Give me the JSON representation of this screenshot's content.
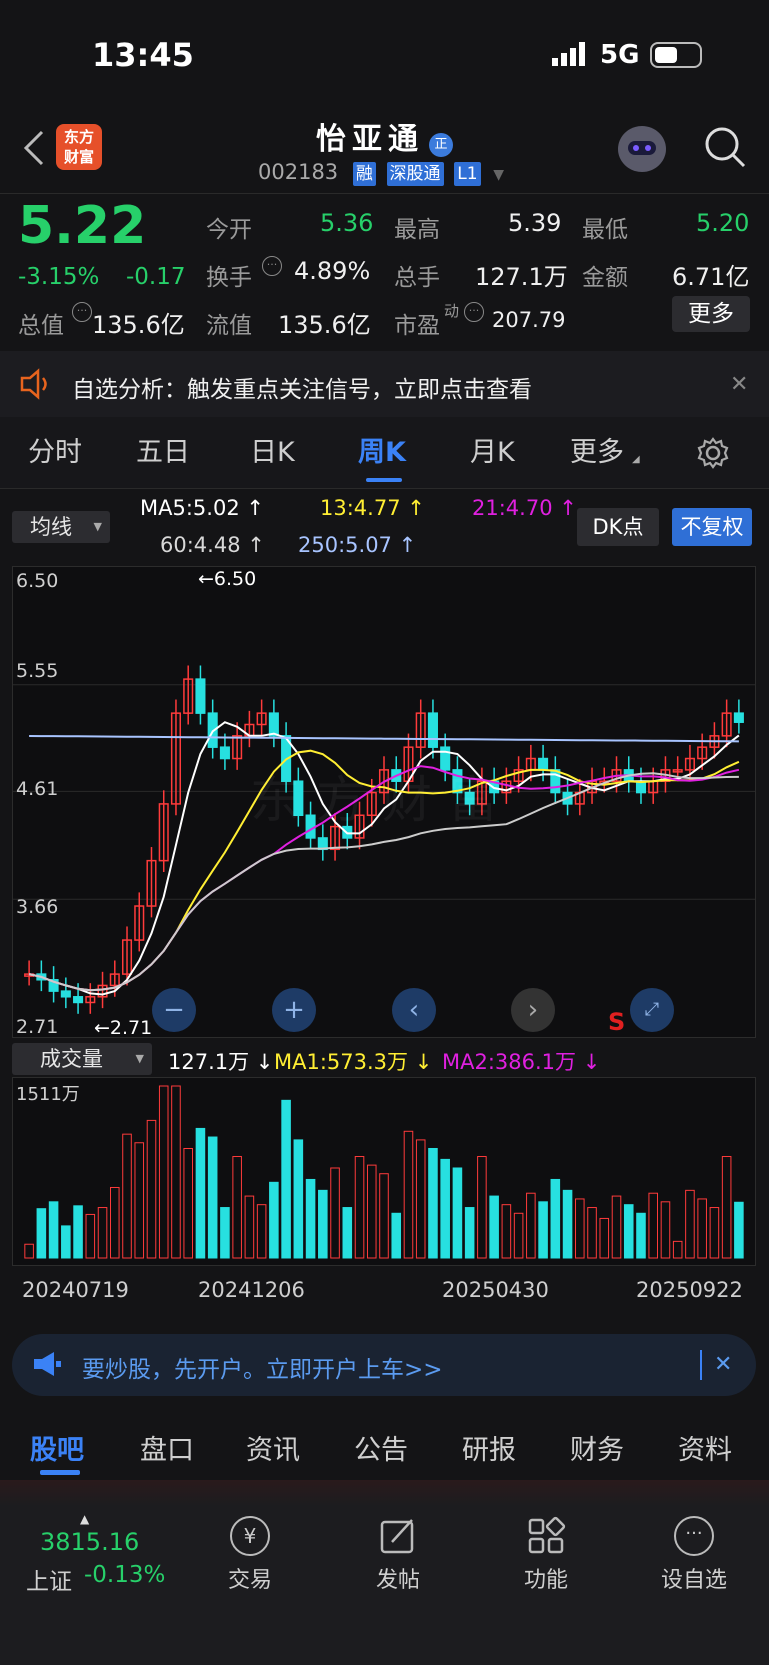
{
  "status_bar": {
    "time": "13:45",
    "network": "5G"
  },
  "header": {
    "title": "怡亚通",
    "title_badge": "正",
    "code": "002183",
    "tags": [
      "融",
      "深股通",
      "L1"
    ],
    "logo_text_1": "东方",
    "logo_text_2": "财富"
  },
  "quote": {
    "price": "5.22",
    "change_pct": "-3.15%",
    "change": "-0.17",
    "open_label": "今开",
    "open": "5.36",
    "high_label": "最高",
    "high": "5.39",
    "low_label": "最低",
    "low": "5.20",
    "turnover_label": "换手",
    "turnover": "4.89%",
    "volume_label": "总手",
    "volume": "127.1万",
    "amount_label": "金额",
    "amount": "6.71亿",
    "mktcap_label": "总值",
    "mktcap": "135.6亿",
    "float_label": "流值",
    "float": "135.6亿",
    "pe_label": "市盈",
    "pe_sup": "动",
    "pe": "207.79",
    "more_button": "更多"
  },
  "notice": {
    "text": "自选分析：触发重点关注信号，立即点击查看"
  },
  "period_tabs": [
    "分时",
    "五日",
    "日K",
    "周K",
    "月K",
    "更多"
  ],
  "active_period": "周K",
  "ma_bar": {
    "dropdown": "均线",
    "ma5": "MA5:5.02",
    "ma13": "13:4.77",
    "ma21": "21:4.70",
    "ma60": "60:4.48",
    "ma250": "250:5.07",
    "dk_button": "DK点",
    "adjust_button": "不复权"
  },
  "price_axis": {
    "labels": [
      "6.50",
      "5.55",
      "4.61",
      "3.66",
      "2.71"
    ],
    "max_marker": "←6.50",
    "min_marker": "←2.71"
  },
  "volume_bar": {
    "dropdown": "成交量",
    "vol": "127.1万",
    "ma1": "MA1:573.3万",
    "ma2": "MA2:386.1万",
    "max_label": "1511万"
  },
  "date_axis": [
    "20240719",
    "20241206",
    "20250430",
    "20250922"
  ],
  "signal_marker": "S",
  "banner": {
    "text": "要炒股，先开户。立即开户上车>>"
  },
  "content_tabs": [
    "股吧",
    "盘口",
    "资讯",
    "公告",
    "研报",
    "财务",
    "资料"
  ],
  "active_content_tab": "股吧",
  "bottom_nav": {
    "index_value": "3815.16",
    "index_name": "上证",
    "index_change": "-0.13%",
    "items": [
      "交易",
      "发帖",
      "功能",
      "设自选"
    ]
  },
  "colors": {
    "up": "#ff3b3b",
    "down": "#27e0e0",
    "ma5": "#ffffff",
    "ma13": "#ffee33",
    "ma21": "#e020e0",
    "ma60": "#cccccc",
    "ma250": "#a8c4ff",
    "accent": "#3b82f6"
  }
}
